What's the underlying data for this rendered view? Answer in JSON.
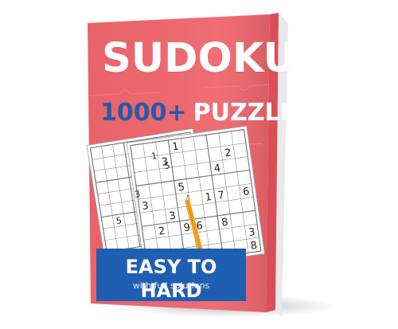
{
  "cover": {
    "title": "SUDOKU",
    "count": "1000+",
    "subtitle_word": "PUZZLES",
    "banner_title": "EASY TO HARD",
    "banner_subtitle": "with full solutions",
    "colors": {
      "cover": "#f0666d",
      "spine": "#d94f57",
      "banner": "#1f5fb3",
      "count_text": "#245aa8",
      "pencil": "#f4a51c"
    }
  },
  "back_grid_digits": [
    "1",
    "5",
    "3",
    "5"
  ],
  "front_grid_digits": [
    "1",
    "3",
    "2",
    "4",
    "5",
    "1",
    "7",
    "3",
    "6",
    "3",
    "9",
    "8",
    "2",
    "6",
    "3",
    "1",
    "5",
    "8"
  ]
}
